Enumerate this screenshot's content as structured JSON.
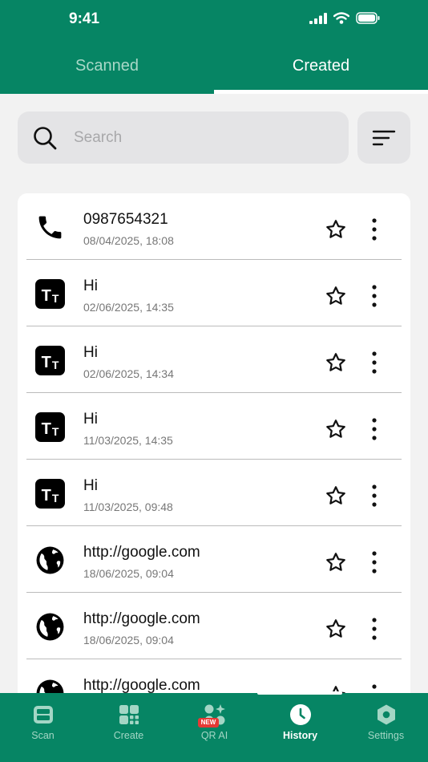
{
  "status_bar": {
    "time": "9:41"
  },
  "tabs": [
    {
      "label": "Scanned",
      "active": false
    },
    {
      "label": "Created",
      "active": true
    }
  ],
  "search": {
    "placeholder": "Search",
    "value": ""
  },
  "items": [
    {
      "type": "phone-icon",
      "title": "0987654321",
      "date": "08/04/2025, 18:08"
    },
    {
      "type": "text-icon",
      "title": "Hi",
      "date": "02/06/2025, 14:35"
    },
    {
      "type": "text-icon",
      "title": "Hi",
      "date": "02/06/2025, 14:34"
    },
    {
      "type": "text-icon",
      "title": "Hi",
      "date": "11/03/2025, 14:35"
    },
    {
      "type": "text-icon",
      "title": "Hi",
      "date": "11/03/2025, 09:48"
    },
    {
      "type": "globe-icon",
      "title": "http://google.com",
      "date": "18/06/2025, 09:04"
    },
    {
      "type": "globe-icon",
      "title": "http://google.com",
      "date": "18/06/2025, 09:04"
    },
    {
      "type": "globe-icon",
      "title": "http://google.com",
      "date": ""
    }
  ],
  "bottom_nav": [
    {
      "label": "Scan",
      "icon": "scan-icon"
    },
    {
      "label": "Create",
      "icon": "create-icon"
    },
    {
      "label": "QR AI",
      "icon": "qr-ai-icon",
      "badge": "NEW"
    },
    {
      "label": "History",
      "icon": "history-icon",
      "active": true
    },
    {
      "label": "Settings",
      "icon": "settings-icon"
    }
  ],
  "colors": {
    "primary": "#068564",
    "inactive_tab": "#a9d8c8",
    "badge": "#e53935"
  }
}
